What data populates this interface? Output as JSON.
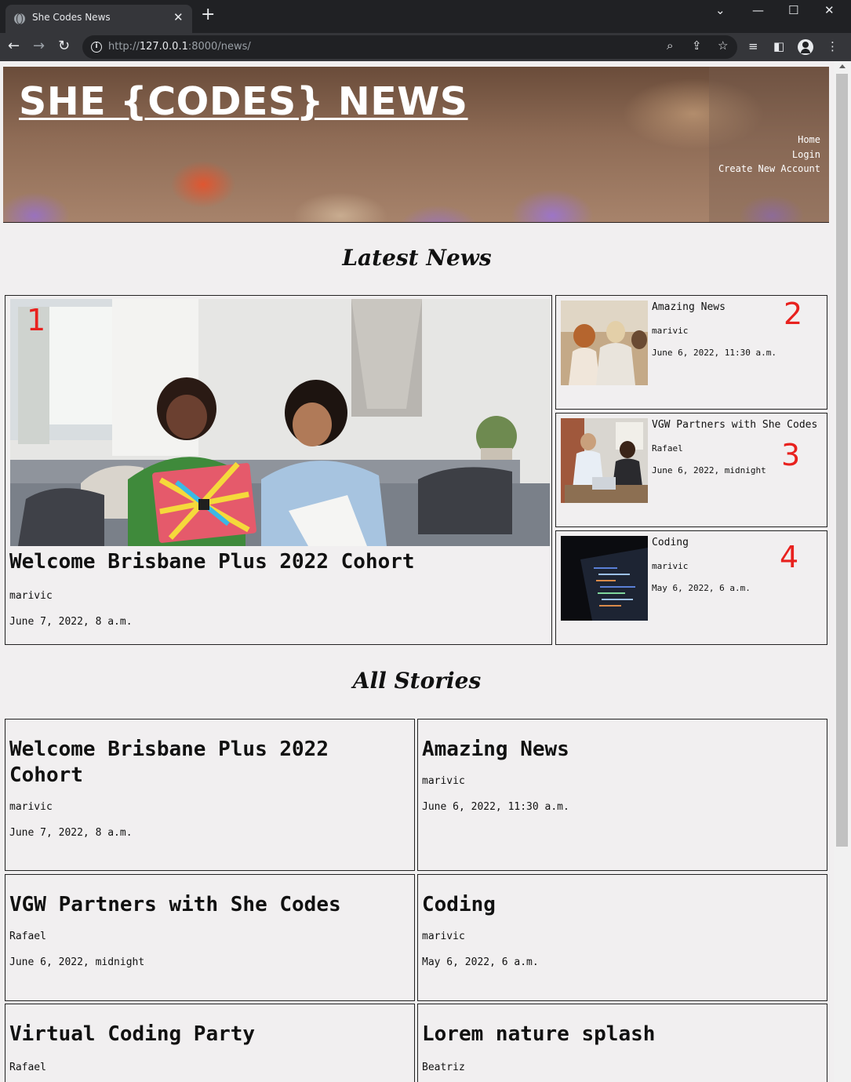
{
  "browser": {
    "tab_title": "She Codes News",
    "url_scheme": "http://",
    "url_host": "127.0.0.1",
    "url_path": ":8000/news/"
  },
  "header": {
    "site_title": "SHE {CODES} NEWS",
    "nav": [
      "Home",
      "Login",
      "Create New Account"
    ]
  },
  "latest": {
    "heading": "Latest News",
    "featured": {
      "title": "Welcome Brisbane Plus 2022 Cohort",
      "author": "marivic",
      "date": "June 7, 2022, 8 a.m.",
      "marker": "1"
    },
    "side": [
      {
        "title": "Amazing News",
        "author": "marivic",
        "date": "June 6, 2022, 11:30 a.m.",
        "marker": "2"
      },
      {
        "title": "VGW Partners with She Codes",
        "author": "Rafael",
        "date": "June 6, 2022, midnight",
        "marker": "3"
      },
      {
        "title": "Coding",
        "author": "marivic",
        "date": "May 6, 2022, 6 a.m.",
        "marker": "4"
      }
    ]
  },
  "all_stories": {
    "heading": "All Stories",
    "items": [
      {
        "title": "Welcome Brisbane Plus 2022 Cohort",
        "author": "marivic",
        "date": "June 7, 2022, 8 a.m."
      },
      {
        "title": "Amazing News",
        "author": "marivic",
        "date": "June 6, 2022, 11:30 a.m."
      },
      {
        "title": "VGW Partners with She Codes",
        "author": "Rafael",
        "date": "June 6, 2022, midnight"
      },
      {
        "title": "Coding",
        "author": "marivic",
        "date": "May 6, 2022, 6 a.m."
      },
      {
        "title": "Virtual Coding Party",
        "author": "Rafael"
      },
      {
        "title": "Lorem nature splash",
        "author": "Beatriz"
      }
    ]
  },
  "colors": {
    "page_bg": "#f1eff0",
    "marker": "#e8211e",
    "chrome_dark": "#202124",
    "chrome_mid": "#35363a"
  }
}
